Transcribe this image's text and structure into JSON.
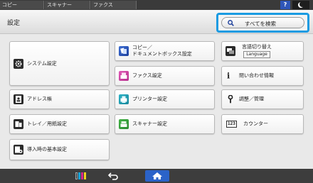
{
  "topbar": {
    "tabs": [
      "コピー",
      "スキャナー",
      "ファクス"
    ],
    "help_label": "?"
  },
  "header": {
    "title": "設定",
    "search_label": "すべてを検索"
  },
  "column1": {
    "system": "システム設定",
    "address": "アドレス帳",
    "tray": "トレイ／用紙設定",
    "initial": "導入時の基本設定"
  },
  "column2": {
    "copy_line1": "コピー／",
    "copy_line2": "ドキュメントボックス設定",
    "fax": "ファクス設定",
    "printer": "プリンター設定",
    "scanner": "スキャナー設定"
  },
  "column3": {
    "language_line1": "言語切り替え",
    "language_line2": "Language",
    "inquiry": "問い合わせ情報",
    "maintenance": "調整／管理",
    "counter": "カウンター",
    "counter_icon_text": "123"
  },
  "colors": {
    "accent": "#1a9be2",
    "home": "#2b63c9",
    "fax_icon": "#e05ab7",
    "printer_icon": "#2bb3c6",
    "scanner_icon": "#43b347",
    "copy_icon": "#3e6fd4"
  }
}
